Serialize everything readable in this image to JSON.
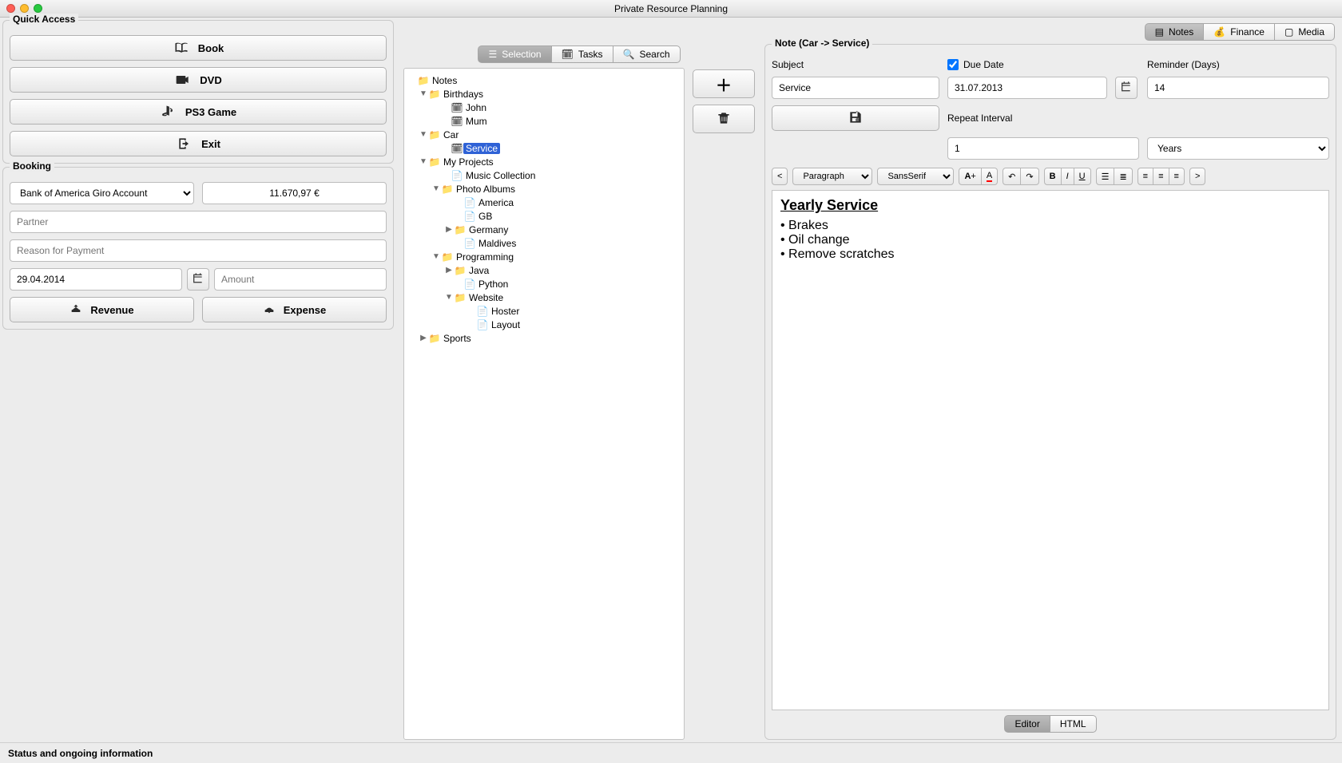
{
  "window": {
    "title": "Private Resource Planning"
  },
  "quick_access": {
    "title": "Quick Access",
    "buttons": [
      {
        "id": "book",
        "label": "Book"
      },
      {
        "id": "dvd",
        "label": "DVD"
      },
      {
        "id": "ps3",
        "label": "PS3 Game"
      },
      {
        "id": "exit",
        "label": "Exit"
      }
    ]
  },
  "booking": {
    "title": "Booking",
    "account": "Bank of America Giro Account",
    "balance": "11.670,97 €",
    "partner_placeholder": "Partner",
    "reason_placeholder": "Reason for Payment",
    "date": "29.04.2014",
    "amount_placeholder": "Amount",
    "revenue_label": "Revenue",
    "expense_label": "Expense"
  },
  "middle": {
    "tabs": {
      "selection": "Selection",
      "tasks": "Tasks",
      "search": "Search"
    },
    "tree": {
      "root": "Notes",
      "birthdays": "Birthdays",
      "john": "John",
      "mum": "Mum",
      "car": "Car",
      "service": "Service",
      "my_projects": "My Projects",
      "music": "Music Collection",
      "photo": "Photo Albums",
      "america": "America",
      "gb": "GB",
      "germany": "Germany",
      "maldives": "Maldives",
      "programming": "Programming",
      "java": "Java",
      "python": "Python",
      "website": "Website",
      "hoster": "Hoster",
      "layout": "Layout",
      "sports": "Sports"
    }
  },
  "top_tabs": {
    "notes": "Notes",
    "finance": "Finance",
    "media": "Media"
  },
  "note": {
    "panel_title": "Note (Car -> Service)",
    "subject_label": "Subject",
    "subject_value": "Service",
    "due_date_label": "Due Date",
    "due_date_checked": true,
    "due_date_value": "31.07.2013",
    "reminder_label": "Reminder (Days)",
    "reminder_value": "14",
    "repeat_label": "Repeat Interval",
    "repeat_value": "1",
    "repeat_unit": "Years",
    "toolbar": {
      "collapse": "<",
      "block_format": "Paragraph",
      "font_family": "SansSerif",
      "expand": ">"
    },
    "content": {
      "heading": "Yearly Service",
      "items": [
        "Brakes",
        "Oil change",
        "Remove scratches"
      ]
    },
    "view_tabs": {
      "editor": "Editor",
      "html": "HTML"
    }
  },
  "status": "Status and ongoing information"
}
